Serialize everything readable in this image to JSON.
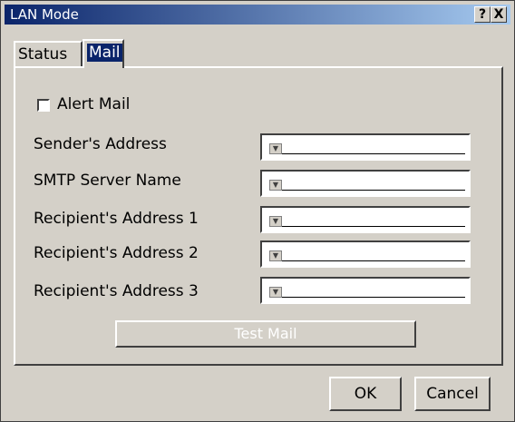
{
  "window": {
    "title": "LAN Mode",
    "help_label": "?",
    "close_label": "X"
  },
  "tabs": [
    {
      "label": "Status",
      "selected": false
    },
    {
      "label": "Mail",
      "selected": true
    }
  ],
  "mail": {
    "alert_mail_label": "Alert Mail",
    "alert_mail_checked": false,
    "fields": [
      {
        "label": "Sender's Address",
        "value": ""
      },
      {
        "label": "SMTP Server Name",
        "value": ""
      },
      {
        "label": "Recipient's Address 1",
        "value": ""
      },
      {
        "label": "Recipient's Address 2",
        "value": ""
      },
      {
        "label": "Recipient's Address 3",
        "value": ""
      }
    ],
    "test_mail_label": "Test Mail"
  },
  "buttons": {
    "ok_label": "OK",
    "cancel_label": "Cancel"
  },
  "colors": {
    "titlebar_start": "#0a246a",
    "titlebar_end": "#a6caf0",
    "face": "#d4d0c8"
  }
}
